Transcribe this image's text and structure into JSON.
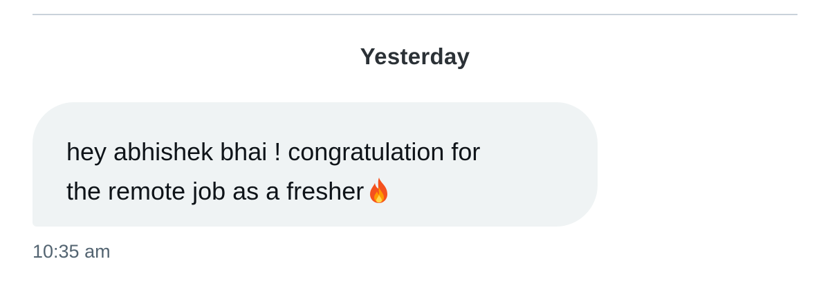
{
  "conversation": {
    "date_separator": "Yesterday",
    "messages": [
      {
        "text": "hey abhishek bhai ! congratulation for\nthe remote job as a fresher",
        "emoji": "fire-icon",
        "time": "10:35 am"
      }
    ]
  },
  "colors": {
    "bubble_background": "#eff3f4",
    "text": "#0f1419",
    "muted_text": "#536471",
    "divider": "#c9d2da"
  }
}
